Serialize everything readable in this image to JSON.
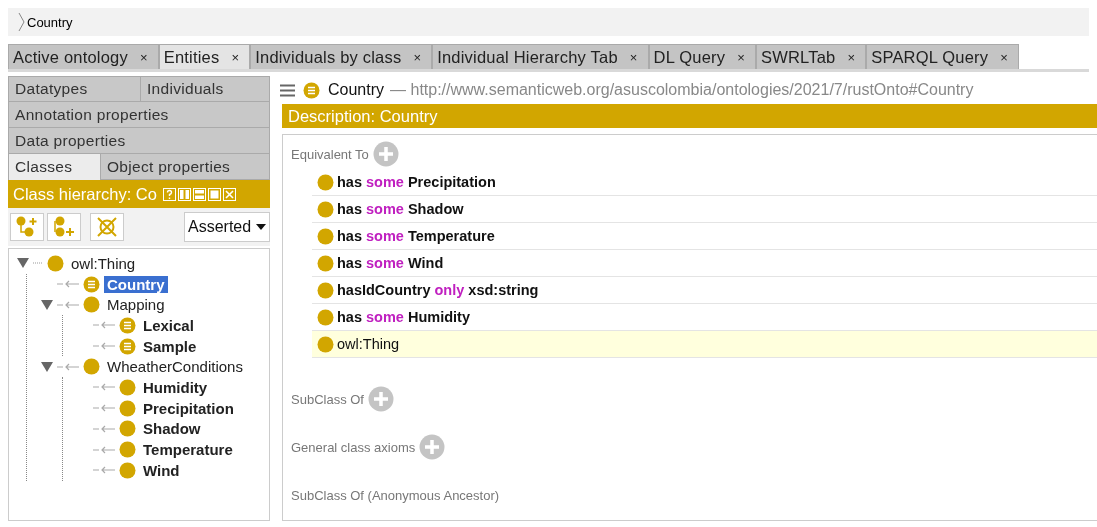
{
  "breadcrumb": {
    "label": "Country"
  },
  "tabs": [
    {
      "label": "Active ontology",
      "selected": false,
      "close": "×"
    },
    {
      "label": "Entities",
      "selected": true,
      "close": "×"
    },
    {
      "label": "Individuals by class",
      "selected": false,
      "close": "×"
    },
    {
      "label": "Individual Hierarchy Tab",
      "selected": false,
      "close": "×"
    },
    {
      "label": "DL Query",
      "selected": false,
      "close": "×"
    },
    {
      "label": "SWRLTab",
      "selected": false,
      "close": "×"
    },
    {
      "label": "SPARQL Query",
      "selected": false,
      "close": "×"
    }
  ],
  "entity_tabs": [
    [
      {
        "label": "Datatypes",
        "selected": false
      },
      {
        "label": "Individuals",
        "selected": false
      }
    ],
    [
      {
        "label": "Annotation properties",
        "selected": false
      }
    ],
    [
      {
        "label": "Data properties",
        "selected": false
      }
    ],
    [
      {
        "label": "Classes",
        "selected": true
      },
      {
        "label": "Object properties",
        "selected": false
      }
    ]
  ],
  "class_hierarchy": {
    "title": "Class hierarchy: Co",
    "mode": "Asserted",
    "tree": [
      {
        "label": "owl:Thing",
        "bold": false,
        "defined": false,
        "selected": false,
        "expanded": true,
        "children": [
          {
            "label": "Country",
            "bold": true,
            "defined": true,
            "selected": true,
            "expanded": false
          },
          {
            "label": "Mapping",
            "bold": false,
            "defined": false,
            "selected": false,
            "expanded": true,
            "children": [
              {
                "label": "Lexical",
                "bold": true,
                "defined": true,
                "selected": false,
                "expanded": false
              },
              {
                "label": "Sample",
                "bold": true,
                "defined": true,
                "selected": false,
                "expanded": false
              }
            ]
          },
          {
            "label": "WheatherConditions",
            "bold": false,
            "defined": false,
            "selected": false,
            "expanded": true,
            "children": [
              {
                "label": "Humidity",
                "bold": true,
                "defined": false,
                "selected": false,
                "expanded": false
              },
              {
                "label": "Precipitation",
                "bold": true,
                "defined": false,
                "selected": false,
                "expanded": false
              },
              {
                "label": "Shadow",
                "bold": true,
                "defined": false,
                "selected": false,
                "expanded": false
              },
              {
                "label": "Temperature",
                "bold": true,
                "defined": false,
                "selected": false,
                "expanded": false
              },
              {
                "label": "Wind",
                "bold": true,
                "defined": false,
                "selected": false,
                "expanded": false
              }
            ]
          }
        ]
      }
    ]
  },
  "entity_header": {
    "name": "Country",
    "iri": "— http://www.semanticweb.org/asuscolombia/ontologies/2021/7/rustOnto#Country"
  },
  "description": {
    "title": "Description: Country",
    "sections": [
      {
        "title": "Equivalent To",
        "items": [
          {
            "kind": "restriction",
            "property": "has",
            "quantifier": "some",
            "filler": "Precipitation",
            "selected": false
          },
          {
            "kind": "restriction",
            "property": "has",
            "quantifier": "some",
            "filler": "Shadow",
            "selected": false
          },
          {
            "kind": "restriction",
            "property": "has",
            "quantifier": "some",
            "filler": "Temperature",
            "selected": false
          },
          {
            "kind": "restriction",
            "property": "has",
            "quantifier": "some",
            "filler": "Wind",
            "selected": false
          },
          {
            "kind": "restriction",
            "property": "hasIdCountry",
            "quantifier": "only",
            "filler": "xsd:string",
            "selected": false
          },
          {
            "kind": "restriction",
            "property": "has",
            "quantifier": "some",
            "filler": "Humidity",
            "selected": false
          },
          {
            "kind": "class",
            "filler": "owl:Thing",
            "selected": true
          }
        ],
        "kind": "editable"
      },
      {
        "title": "SubClass Of",
        "kind": "editable"
      },
      {
        "title": "General class axioms",
        "kind": "editable"
      },
      {
        "title": "SubClass Of (Anonymous Ancestor)",
        "kind": "inferred"
      }
    ]
  }
}
